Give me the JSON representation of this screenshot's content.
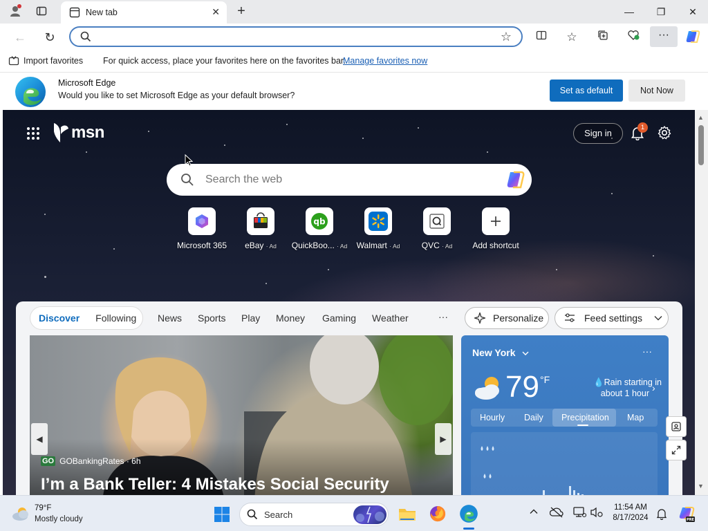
{
  "browser": {
    "tab_title": "New tab",
    "address_value": "",
    "favorites_bar": {
      "import_label": "Import favorites",
      "message": "For quick access, place your favorites here on the favorites bar.",
      "manage_link": "Manage favorites now"
    },
    "banner": {
      "title": "Microsoft Edge",
      "message": "Would you like to set Microsoft Edge as your default browser?",
      "primary_button": "Set as default",
      "secondary_button": "Not Now"
    }
  },
  "msn": {
    "logo_text": "msn",
    "sign_in": "Sign in",
    "notification_count": "1",
    "search_placeholder": "Search the web",
    "shortcuts": [
      {
        "label": "Microsoft 365",
        "ad": "",
        "icon": "microsoft365-icon"
      },
      {
        "label": "eBay",
        "ad": "· Ad",
        "icon": "ebay-icon"
      },
      {
        "label": "QuickBoo...",
        "ad": "· Ad",
        "icon": "quickbooks-icon"
      },
      {
        "label": "Walmart",
        "ad": "· Ad",
        "icon": "walmart-icon"
      },
      {
        "label": "QVC",
        "ad": "· Ad",
        "icon": "qvc-icon"
      },
      {
        "label": "Add shortcut",
        "ad": "",
        "icon": "plus-icon"
      }
    ],
    "feed_tabs": {
      "discover": "Discover",
      "following": "Following",
      "categories": [
        "News",
        "Sports",
        "Play",
        "Money",
        "Gaming",
        "Weather"
      ],
      "more": "···"
    },
    "personalize": "Personalize",
    "feed_settings": "Feed settings",
    "article": {
      "source_badge": "GO",
      "source": "GOBankingRates · 6h",
      "headline": "I’m a Bank Teller: 4 Mistakes Social Security"
    },
    "weather": {
      "location": "New York",
      "temp": "79",
      "unit": "°F",
      "alert_line1": "Rain starting in",
      "alert_line2": "about 1 hour",
      "tabs": [
        "Hourly",
        "Daily",
        "Precipitation",
        "Map"
      ],
      "active_tab": "Precipitation",
      "more": "···"
    }
  },
  "taskbar": {
    "weather_temp": "79°F",
    "weather_desc": "Mostly cloudy",
    "search_label": "Search",
    "time": "11:54 AM",
    "date": "8/17/2024"
  },
  "colors": {
    "accent": "#0f6cbd",
    "link": "#1a5fb4",
    "weather_bg": "#3f7fc6",
    "notification_badge": "#e05a2b"
  }
}
